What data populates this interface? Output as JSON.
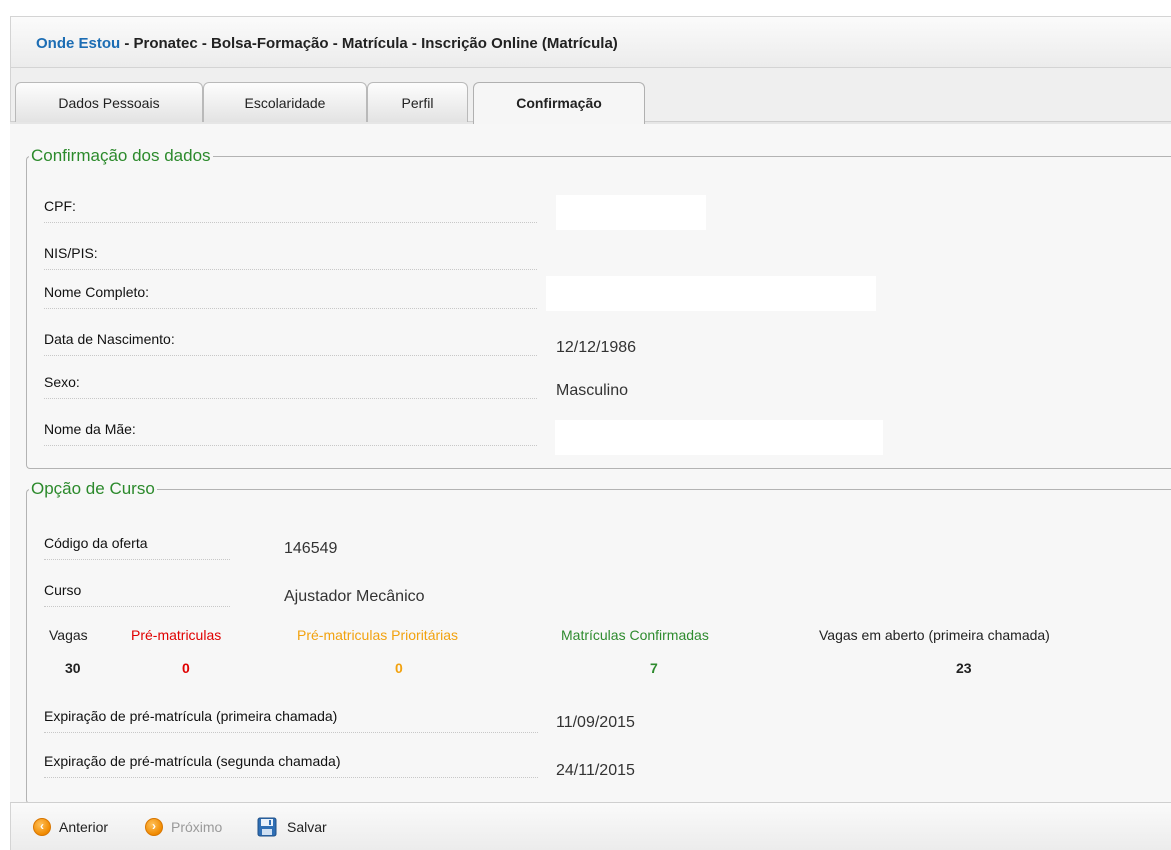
{
  "breadcrumb": {
    "here_label": "Onde Estou",
    "path": " - Pronatec - Bolsa-Formação - Matrícula - Inscrição Online (Matrícula)"
  },
  "tabs": [
    {
      "label": "Dados Pessoais",
      "active": false
    },
    {
      "label": "Escolaridade",
      "active": false
    },
    {
      "label": "Perfil",
      "active": false
    },
    {
      "label": "Confirmação",
      "active": true
    }
  ],
  "confirmation": {
    "legend": "Confirmação dos dados",
    "fields": [
      {
        "label": "CPF:",
        "value": ""
      },
      {
        "label": "NIS/PIS:",
        "value": ""
      },
      {
        "label": "Nome Completo:",
        "value": ""
      },
      {
        "label": "Data de Nascimento:",
        "value": "12/12/1986"
      },
      {
        "label": "Sexo:",
        "value": "Masculino"
      },
      {
        "label": "Nome da Mãe:",
        "value": ""
      }
    ]
  },
  "course": {
    "legend": "Opção de Curso",
    "offer_code_label": "Código da oferta",
    "offer_code": "146549",
    "course_label": "Curso",
    "course_name": "Ajustador Mecânico",
    "stats": {
      "headers": [
        "Vagas",
        "Pré-matriculas",
        "Pré-matriculas Prioritárias",
        "Matrículas Confirmadas",
        "Vagas em aberto (primeira chamada)"
      ],
      "values": [
        "30",
        "0",
        "0",
        "7",
        "23"
      ],
      "colors": [
        "#222222",
        "#e00000",
        "#f2a20f",
        "#2e8b2e",
        "#222222"
      ]
    },
    "expiration_first_label": "Expiração de pré-matrícula (primeira chamada)",
    "expiration_first": "11/09/2015",
    "expiration_second_label": "Expiração de pré-matrícula (segunda chamada)",
    "expiration_second": "24/11/2015"
  },
  "footer": {
    "previous_label": "Anterior",
    "next_label": "Próximo",
    "save_label": "Salvar",
    "icons": [
      "arrow-left-icon",
      "arrow-right-icon",
      "floppy-disk-icon"
    ]
  }
}
